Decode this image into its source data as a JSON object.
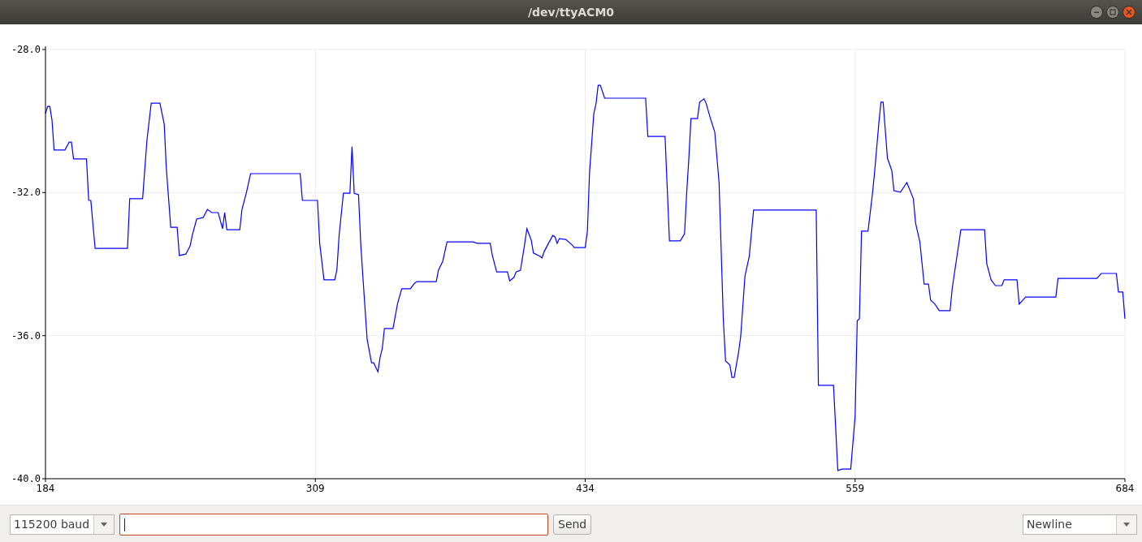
{
  "window": {
    "title": "/dev/ttyACM0"
  },
  "plot": {
    "chart_data": {
      "type": "line",
      "grid": true,
      "xlim": [
        184,
        684
      ],
      "ylim": [
        -40,
        -28
      ],
      "xticks": [
        184,
        309,
        434,
        559,
        684
      ],
      "yticks": [
        {
          "value": -40,
          "label": "-40.0"
        },
        {
          "value": -36,
          "label": "-36.0"
        },
        {
          "value": -32,
          "label": "-32.0"
        },
        {
          "value": -28,
          "label": "-28.0"
        }
      ],
      "x": [
        184,
        185,
        186,
        187,
        188,
        193,
        195,
        196,
        197,
        203,
        204,
        205,
        207,
        222,
        223,
        229,
        231,
        233,
        237,
        239,
        240,
        242,
        245,
        246,
        249,
        251,
        252,
        254,
        257,
        259,
        261,
        264,
        266,
        267,
        268,
        274,
        275,
        277,
        279,
        302,
        303,
        310,
        311,
        313,
        318,
        319,
        320,
        322,
        325,
        326,
        327,
        329,
        330,
        331,
        333,
        335,
        336,
        338,
        339,
        340,
        341,
        345,
        347,
        349,
        353,
        355,
        356,
        365,
        366,
        368,
        370,
        382,
        384,
        390,
        391,
        393,
        398,
        399,
        401,
        402,
        404,
        406,
        407,
        409,
        410,
        413,
        414,
        415,
        417,
        419,
        420,
        421,
        422,
        425,
        428,
        429,
        434,
        435,
        436,
        438,
        439,
        440,
        441,
        443,
        462,
        463,
        471,
        472,
        473,
        478,
        480,
        481,
        482,
        483,
        486,
        487,
        489,
        490,
        492,
        494,
        496,
        498,
        499,
        501,
        502,
        503,
        505,
        506,
        508,
        510,
        512,
        541,
        542,
        549,
        551,
        553,
        557,
        559,
        560,
        561,
        562,
        565,
        567,
        568,
        570,
        571,
        572,
        574,
        576,
        577,
        580,
        583,
        586,
        587,
        589,
        591,
        593,
        594,
        596,
        598,
        603,
        604,
        608,
        619,
        620,
        622,
        624,
        627,
        628,
        634,
        635,
        638,
        652,
        653,
        671,
        673,
        680,
        681,
        683,
        684
      ],
      "series": [
        {
          "color": "#0000ff",
          "values": [
            -29.79,
            -29.59,
            -29.59,
            -29.97,
            -30.81,
            -30.81,
            -30.59,
            -30.59,
            -31.06,
            -31.06,
            -32.22,
            -32.22,
            -33.56,
            -33.56,
            -32.17,
            -32.17,
            -30.54,
            -29.5,
            -29.5,
            -30.09,
            -31.33,
            -32.97,
            -32.97,
            -33.76,
            -33.72,
            -33.49,
            -33.2,
            -32.74,
            -32.7,
            -32.47,
            -32.56,
            -32.56,
            -33.01,
            -32.56,
            -33.04,
            -33.04,
            -32.47,
            -32.02,
            -31.47,
            -31.47,
            -32.22,
            -32.22,
            -33.42,
            -34.44,
            -34.44,
            -34.15,
            -33.2,
            -32.02,
            -32.02,
            -30.72,
            -32.02,
            -32.06,
            -33.42,
            -34.33,
            -36.1,
            -36.76,
            -36.76,
            -37.01,
            -36.6,
            -36.37,
            -35.8,
            -35.8,
            -35.12,
            -34.69,
            -34.69,
            -34.53,
            -34.49,
            -34.49,
            -34.17,
            -33.92,
            -33.38,
            -33.38,
            -33.42,
            -33.42,
            -33.76,
            -34.22,
            -34.22,
            -34.47,
            -34.37,
            -34.22,
            -34.17,
            -33.42,
            -33.01,
            -33.33,
            -33.69,
            -33.78,
            -33.83,
            -33.65,
            -33.42,
            -33.2,
            -33.24,
            -33.42,
            -33.29,
            -33.31,
            -33.47,
            -33.54,
            -33.54,
            -33.08,
            -31.45,
            -29.79,
            -29.52,
            -29,
            -29,
            -29.36,
            -29.36,
            -30.43,
            -30.43,
            -31.88,
            -33.35,
            -33.35,
            -33.15,
            -32.02,
            -31.04,
            -29.93,
            -29.93,
            -29.47,
            -29.38,
            -29.5,
            -29.93,
            -30.31,
            -31.72,
            -35.58,
            -36.71,
            -36.82,
            -37.17,
            -37.17,
            -36.48,
            -36.03,
            -34.33,
            -33.78,
            -32.49,
            -32.49,
            -37.39,
            -37.39,
            -39.77,
            -39.73,
            -39.73,
            -38.25,
            -35.58,
            -35.53,
            -33.08,
            -33.08,
            -32.06,
            -31.45,
            -30.06,
            -29.47,
            -29.47,
            -31.04,
            -31.38,
            -31.95,
            -31.99,
            -31.72,
            -32.17,
            -32.85,
            -33.38,
            -34.56,
            -34.56,
            -35.01,
            -35.12,
            -35.3,
            -35.3,
            -34.67,
            -33.04,
            -33.04,
            -33.99,
            -34.44,
            -34.6,
            -34.6,
            -34.44,
            -34.44,
            -35.12,
            -34.92,
            -34.92,
            -34.4,
            -34.4,
            -34.26,
            -34.26,
            -34.78,
            -34.78,
            -35.53
          ]
        }
      ]
    }
  },
  "controls": {
    "baud": {
      "value": "115200 baud"
    },
    "send": {
      "label": "Send"
    },
    "line_ending": {
      "value": "Newline"
    }
  }
}
